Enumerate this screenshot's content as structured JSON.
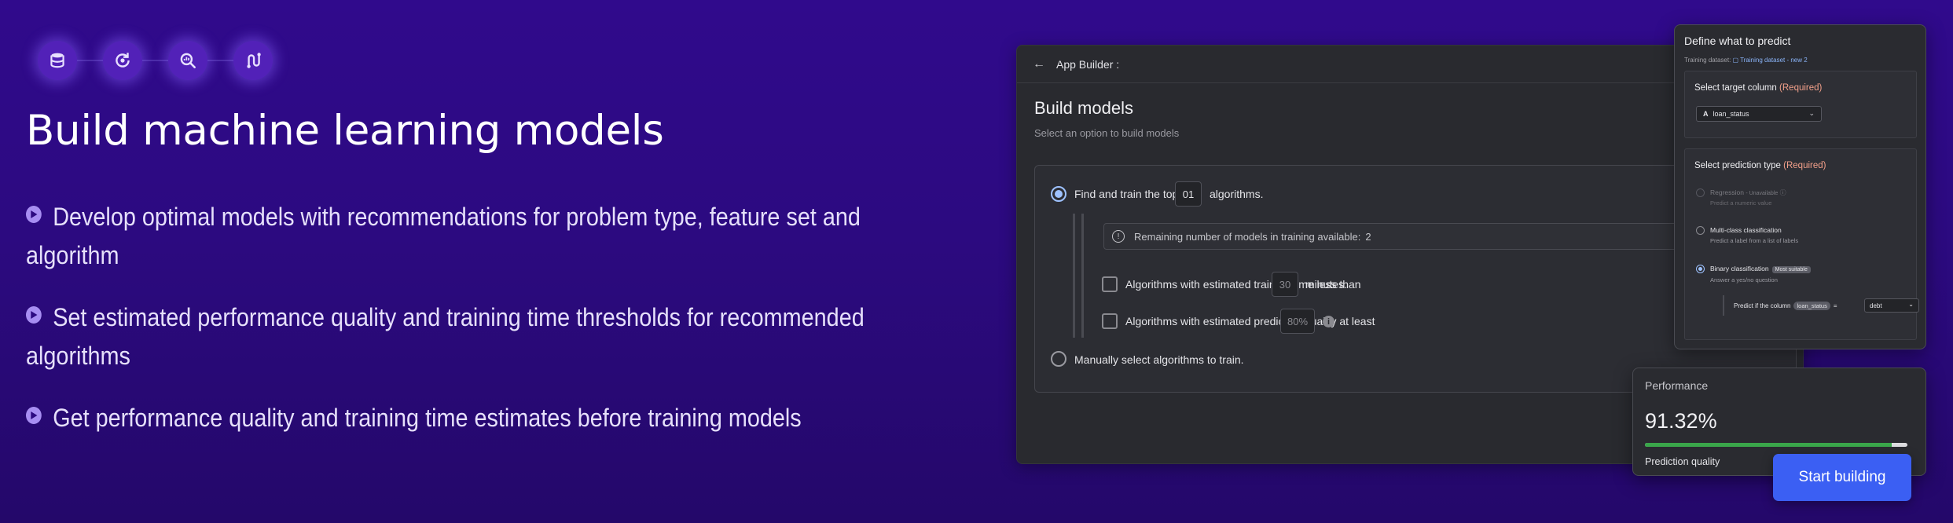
{
  "hero": {
    "title": "Build machine learning models",
    "icons": [
      "database-icon",
      "refresh-icon",
      "search-chart-icon",
      "route-icon"
    ],
    "bullets": [
      "Develop optimal models with recommendations for problem type, feature set and algorithm",
      "Set estimated performance quality and training time thresholds for recommended algorithms",
      "Get performance quality and training time estimates before training models"
    ]
  },
  "builder": {
    "breadcrumb": "App Builder :",
    "title": "Build models",
    "subtitle": "Select an option to build models",
    "option_top_prefix": "Find and train the top",
    "option_top_value": "01",
    "option_top_suffix": "algorithms.",
    "remaining_text": "Remaining number of models in training available:",
    "remaining_count": "2",
    "time_label": "Algorithms with estimated training time less than",
    "time_value": "30",
    "time_suffix": "minutes.",
    "quality_label": "Algorithms with estimated prediction quality at least",
    "quality_value": "80%",
    "manual_label": "Manually select algorithms to train."
  },
  "define": {
    "title": "Define what to predict",
    "dataset_label": "Training dataset:",
    "dataset_link": "Training dataset - new 2",
    "target_title": "Select target column",
    "required": "(Required)",
    "target_value": "loan_status",
    "type_title": "Select prediction type",
    "types": [
      {
        "label": "Regression",
        "note": "- Unavailable",
        "desc": "Predict a numeric value"
      },
      {
        "label": "Multi-class classification",
        "note": "",
        "desc": "Predict a label from a list of labels"
      },
      {
        "label": "Binary classification",
        "note": "Most suitable",
        "desc": "Answer a yes/no question"
      }
    ],
    "cond_prefix": "Predict if the column",
    "cond_column": "loan_status",
    "cond_op": "=",
    "cond_value": "debt"
  },
  "performance": {
    "title": "Performance",
    "value": "91.32%",
    "fill": 0.94,
    "label": "Prediction quality"
  },
  "cta": {
    "label": "Start building"
  },
  "colors": {
    "background": "#2c0a80",
    "accent": "#3b5ff3",
    "progress": "#3aa64a",
    "required": "#f3a08a"
  }
}
